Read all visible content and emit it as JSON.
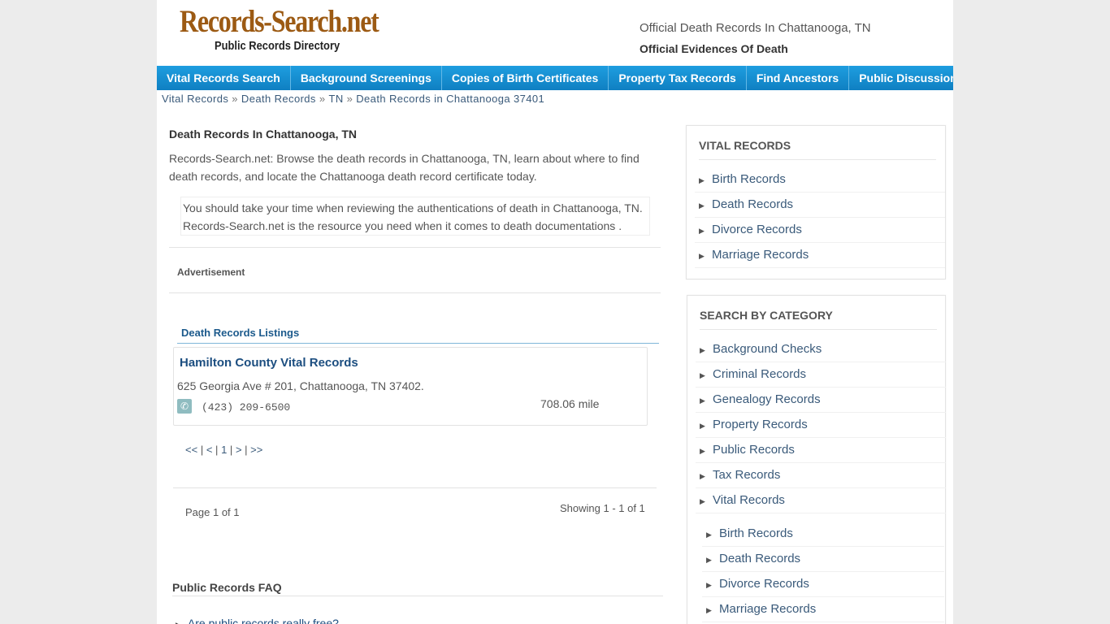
{
  "header": {
    "logo_main": "Records-Search.net",
    "logo_sub": "Public Records Directory",
    "title": "Official Death Records In Chattanooga, TN",
    "subtitle": "Official Evidences Of Death"
  },
  "nav": {
    "items": [
      "Vital Records Search",
      "Background Screenings",
      "Copies of Birth Certificates",
      "Property Tax Records",
      "Find Ancestors",
      "Public Discussion"
    ]
  },
  "breadcrumb": {
    "items": [
      "Vital Records",
      "Death Records",
      "TN",
      "Death Records in Chattanooga 37401"
    ],
    "separator": "»"
  },
  "main": {
    "title": "Death Records In Chattanooga, TN",
    "intro": "Records-Search.net: Browse the death records in Chattanooga, TN, learn about where to find death records, and locate the Chattanooga death record certificate today.",
    "notice": "You should take your time when reviewing the authentications of death in Chattanooga, TN. Records-Search.net is the resource you need when it comes to death documentations .",
    "advertisement_label": "Advertisement",
    "listings_title": "Death Records Listings",
    "listing": {
      "name": "Hamilton County Vital Records",
      "address": "625 Georgia Ave # 201, Chattanooga, TN 37402.",
      "phone": "(423) 209-6500",
      "distance": "708.06 mile"
    },
    "pager": {
      "first": "<<",
      "prev": "<",
      "current": "1",
      "next": ">",
      "last": ">>",
      "sep": "|"
    },
    "page_of": "Page 1 of 1",
    "showing": "Showing 1 - 1 of 1",
    "faq_title": "Public Records FAQ",
    "faq_items": [
      "Are public records really free?"
    ]
  },
  "sidebar": {
    "vital": {
      "title": "VITAL RECORDS",
      "items": [
        "Birth Records",
        "Death Records",
        "Divorce Records",
        "Marriage Records"
      ]
    },
    "category": {
      "title": "SEARCH BY CATEGORY",
      "items": [
        "Background Checks",
        "Criminal Records",
        "Genealogy Records",
        "Property Records",
        "Public Records",
        "Tax Records",
        "Vital Records"
      ],
      "sub_items": [
        "Birth Records",
        "Death Records",
        "Divorce Records",
        "Marriage Records"
      ]
    }
  },
  "colors": {
    "nav_bg": "#1b95d6",
    "logo": "#9c5a13",
    "link": "#3a5a7a",
    "heading_link": "#1c4e80"
  }
}
